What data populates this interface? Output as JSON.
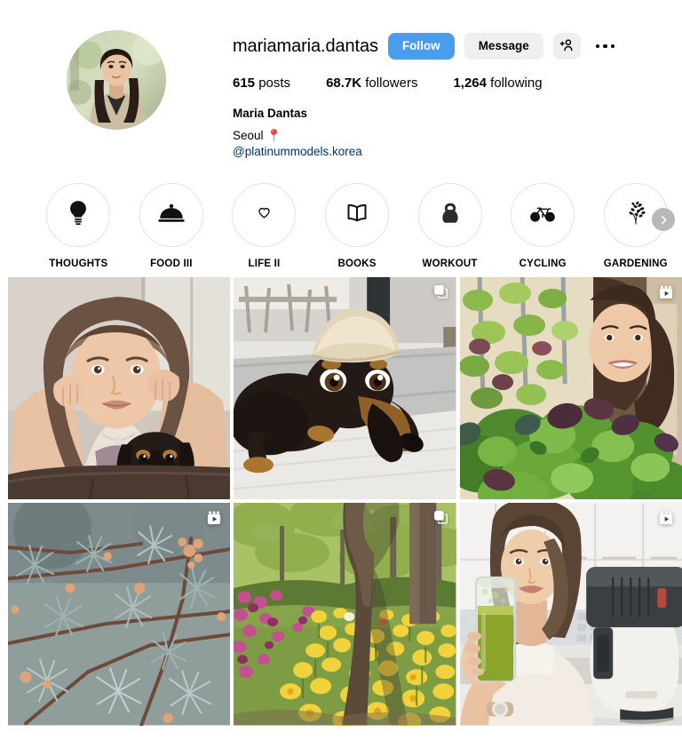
{
  "profile": {
    "username": "mariamaria.dantas",
    "avatar_icon": "profile-photo",
    "buttons": {
      "follow": "Follow",
      "message": "Message",
      "add_person_icon": "add-person-icon",
      "more_icon": "more-options-icon"
    },
    "stats": [
      {
        "value": "615",
        "label": "posts"
      },
      {
        "value": "68.7K",
        "label": "followers"
      },
      {
        "value": "1,264",
        "label": "following"
      }
    ],
    "bio": {
      "full_name": "Maria Dantas",
      "location": "Seoul 📍",
      "link": "@platinummodels.korea"
    }
  },
  "highlights": {
    "next_icon": "chevron-right-icon",
    "items": [
      {
        "label": "THOUGHTS",
        "icon": "lightbulb-icon"
      },
      {
        "label": "FOOD III",
        "icon": "food-cloche-icon"
      },
      {
        "label": "LIFE II",
        "icon": "heart-icon"
      },
      {
        "label": "BOOKS",
        "icon": "open-book-icon"
      },
      {
        "label": "WORKOUT",
        "icon": "kettlebell-icon"
      },
      {
        "label": "CYCLING",
        "icon": "bicycle-icon"
      },
      {
        "label": "GARDENING",
        "icon": "plant-sprig-icon"
      }
    ]
  },
  "grid": {
    "posts": [
      {
        "name": "post-woman-with-dachshund",
        "badge": "none"
      },
      {
        "name": "post-dachshund-with-bread-hat",
        "badge": "carousel"
      },
      {
        "name": "post-hydroponic-greens-harvest",
        "badge": "reels"
      },
      {
        "name": "post-blue-spruce-branches",
        "badge": "reels"
      },
      {
        "name": "post-spring-daffodil-garden",
        "badge": "carousel"
      },
      {
        "name": "post-green-juice-kitchen",
        "badge": "reels"
      }
    ]
  },
  "colors": {
    "accent_blue": "#4a9ded",
    "link_blue": "#00376b",
    "button_gray": "#efefef",
    "ring_gray": "#e3e3e3"
  }
}
